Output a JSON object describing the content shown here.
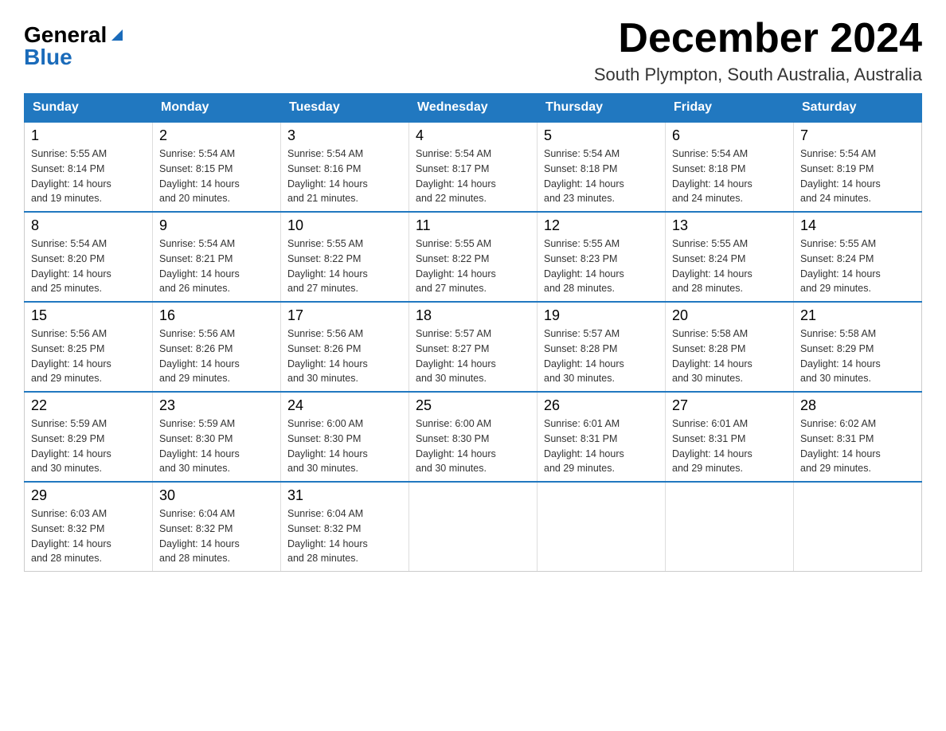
{
  "header": {
    "logo_general": "General",
    "logo_blue": "Blue",
    "month_title": "December 2024",
    "location": "South Plympton, South Australia, Australia"
  },
  "weekdays": [
    "Sunday",
    "Monday",
    "Tuesday",
    "Wednesday",
    "Thursday",
    "Friday",
    "Saturday"
  ],
  "weeks": [
    [
      {
        "day": "1",
        "info": "Sunrise: 5:55 AM\nSunset: 8:14 PM\nDaylight: 14 hours\nand 19 minutes."
      },
      {
        "day": "2",
        "info": "Sunrise: 5:54 AM\nSunset: 8:15 PM\nDaylight: 14 hours\nand 20 minutes."
      },
      {
        "day": "3",
        "info": "Sunrise: 5:54 AM\nSunset: 8:16 PM\nDaylight: 14 hours\nand 21 minutes."
      },
      {
        "day": "4",
        "info": "Sunrise: 5:54 AM\nSunset: 8:17 PM\nDaylight: 14 hours\nand 22 minutes."
      },
      {
        "day": "5",
        "info": "Sunrise: 5:54 AM\nSunset: 8:18 PM\nDaylight: 14 hours\nand 23 minutes."
      },
      {
        "day": "6",
        "info": "Sunrise: 5:54 AM\nSunset: 8:18 PM\nDaylight: 14 hours\nand 24 minutes."
      },
      {
        "day": "7",
        "info": "Sunrise: 5:54 AM\nSunset: 8:19 PM\nDaylight: 14 hours\nand 24 minutes."
      }
    ],
    [
      {
        "day": "8",
        "info": "Sunrise: 5:54 AM\nSunset: 8:20 PM\nDaylight: 14 hours\nand 25 minutes."
      },
      {
        "day": "9",
        "info": "Sunrise: 5:54 AM\nSunset: 8:21 PM\nDaylight: 14 hours\nand 26 minutes."
      },
      {
        "day": "10",
        "info": "Sunrise: 5:55 AM\nSunset: 8:22 PM\nDaylight: 14 hours\nand 27 minutes."
      },
      {
        "day": "11",
        "info": "Sunrise: 5:55 AM\nSunset: 8:22 PM\nDaylight: 14 hours\nand 27 minutes."
      },
      {
        "day": "12",
        "info": "Sunrise: 5:55 AM\nSunset: 8:23 PM\nDaylight: 14 hours\nand 28 minutes."
      },
      {
        "day": "13",
        "info": "Sunrise: 5:55 AM\nSunset: 8:24 PM\nDaylight: 14 hours\nand 28 minutes."
      },
      {
        "day": "14",
        "info": "Sunrise: 5:55 AM\nSunset: 8:24 PM\nDaylight: 14 hours\nand 29 minutes."
      }
    ],
    [
      {
        "day": "15",
        "info": "Sunrise: 5:56 AM\nSunset: 8:25 PM\nDaylight: 14 hours\nand 29 minutes."
      },
      {
        "day": "16",
        "info": "Sunrise: 5:56 AM\nSunset: 8:26 PM\nDaylight: 14 hours\nand 29 minutes."
      },
      {
        "day": "17",
        "info": "Sunrise: 5:56 AM\nSunset: 8:26 PM\nDaylight: 14 hours\nand 30 minutes."
      },
      {
        "day": "18",
        "info": "Sunrise: 5:57 AM\nSunset: 8:27 PM\nDaylight: 14 hours\nand 30 minutes."
      },
      {
        "day": "19",
        "info": "Sunrise: 5:57 AM\nSunset: 8:28 PM\nDaylight: 14 hours\nand 30 minutes."
      },
      {
        "day": "20",
        "info": "Sunrise: 5:58 AM\nSunset: 8:28 PM\nDaylight: 14 hours\nand 30 minutes."
      },
      {
        "day": "21",
        "info": "Sunrise: 5:58 AM\nSunset: 8:29 PM\nDaylight: 14 hours\nand 30 minutes."
      }
    ],
    [
      {
        "day": "22",
        "info": "Sunrise: 5:59 AM\nSunset: 8:29 PM\nDaylight: 14 hours\nand 30 minutes."
      },
      {
        "day": "23",
        "info": "Sunrise: 5:59 AM\nSunset: 8:30 PM\nDaylight: 14 hours\nand 30 minutes."
      },
      {
        "day": "24",
        "info": "Sunrise: 6:00 AM\nSunset: 8:30 PM\nDaylight: 14 hours\nand 30 minutes."
      },
      {
        "day": "25",
        "info": "Sunrise: 6:00 AM\nSunset: 8:30 PM\nDaylight: 14 hours\nand 30 minutes."
      },
      {
        "day": "26",
        "info": "Sunrise: 6:01 AM\nSunset: 8:31 PM\nDaylight: 14 hours\nand 29 minutes."
      },
      {
        "day": "27",
        "info": "Sunrise: 6:01 AM\nSunset: 8:31 PM\nDaylight: 14 hours\nand 29 minutes."
      },
      {
        "day": "28",
        "info": "Sunrise: 6:02 AM\nSunset: 8:31 PM\nDaylight: 14 hours\nand 29 minutes."
      }
    ],
    [
      {
        "day": "29",
        "info": "Sunrise: 6:03 AM\nSunset: 8:32 PM\nDaylight: 14 hours\nand 28 minutes."
      },
      {
        "day": "30",
        "info": "Sunrise: 6:04 AM\nSunset: 8:32 PM\nDaylight: 14 hours\nand 28 minutes."
      },
      {
        "day": "31",
        "info": "Sunrise: 6:04 AM\nSunset: 8:32 PM\nDaylight: 14 hours\nand 28 minutes."
      },
      null,
      null,
      null,
      null
    ]
  ]
}
